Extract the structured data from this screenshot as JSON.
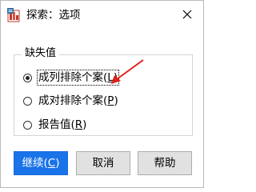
{
  "window": {
    "title": "探索：选项",
    "close_glyph": "✕"
  },
  "missing_values": {
    "legend": "缺失值",
    "options": [
      {
        "label_text": "成列排除个案(",
        "mnemonic": "L",
        "label_end": ")",
        "selected": true
      },
      {
        "label_text": "成对排除个案(",
        "mnemonic": "P",
        "label_end": ")",
        "selected": false
      },
      {
        "label_text": "报告值(",
        "mnemonic": "R",
        "label_end": ")",
        "selected": false
      }
    ]
  },
  "buttons": {
    "continue_text": "继续(",
    "continue_mnemonic": "C",
    "continue_end": ")",
    "cancel": "取消",
    "help": "帮助"
  },
  "colors": {
    "primary": "#1a73e8",
    "annotation_arrow": "#e0201b"
  },
  "icons": {
    "app": "spss-app-icon",
    "close": "close-icon",
    "annotation": "red-arrow-annotation"
  }
}
